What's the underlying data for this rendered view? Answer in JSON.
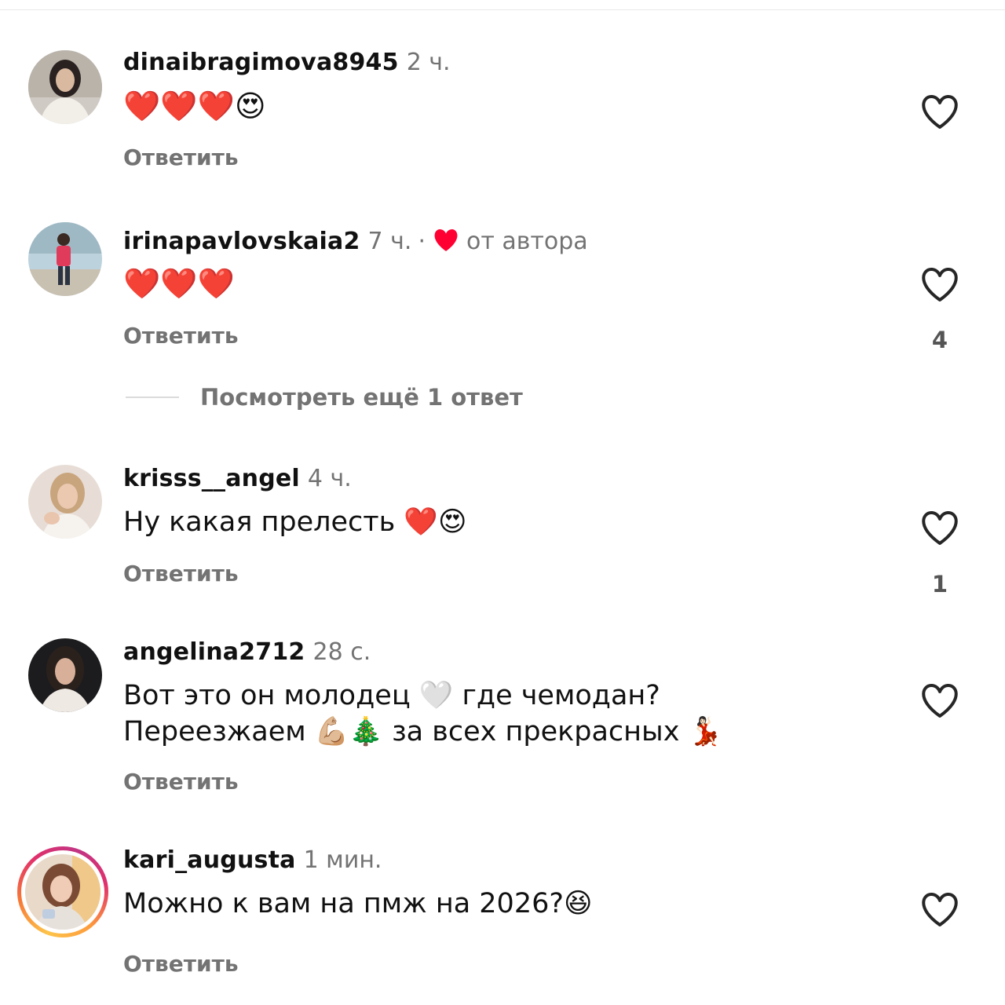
{
  "comments": [
    {
      "username": "dinaibragimova8945",
      "time": "2 ч.",
      "text": "❤️❤️❤️😍",
      "reply_label": "Ответить",
      "like_count": ""
    },
    {
      "username": "irinapavlovskaia2",
      "time": "7 ч.",
      "separator": "·",
      "author_like_label": "от автора",
      "text": "❤️❤️❤️",
      "reply_label": "Ответить",
      "like_count": "4",
      "more_replies": "Посмотреть ещё 1 ответ"
    },
    {
      "username": "krisss__angel",
      "time": "4 ч.",
      "text": "Ну какая прелесть ❤️😍",
      "reply_label": "Ответить",
      "like_count": "1"
    },
    {
      "username": "angelina2712",
      "time": "28 с.",
      "text_line1": "Вот это он молодец 🤍 где чемодан?",
      "text_line2": "Переезжаем 💪🏼🎄 за всех прекрасных 💃🏻",
      "reply_label": "Ответить",
      "like_count": ""
    },
    {
      "username": "kari_augusta",
      "time": "1 мин.",
      "text": "Можно к вам на пмж на 2026?😆",
      "reply_label": "Ответить",
      "like_count": ""
    }
  ],
  "colors": {
    "secondary_text": "#737373",
    "author_heart": "#ff0033",
    "icon_stroke": "#262626"
  },
  "icons": {
    "like": "heart-outline-icon",
    "author_like": "heart-filled-icon"
  }
}
